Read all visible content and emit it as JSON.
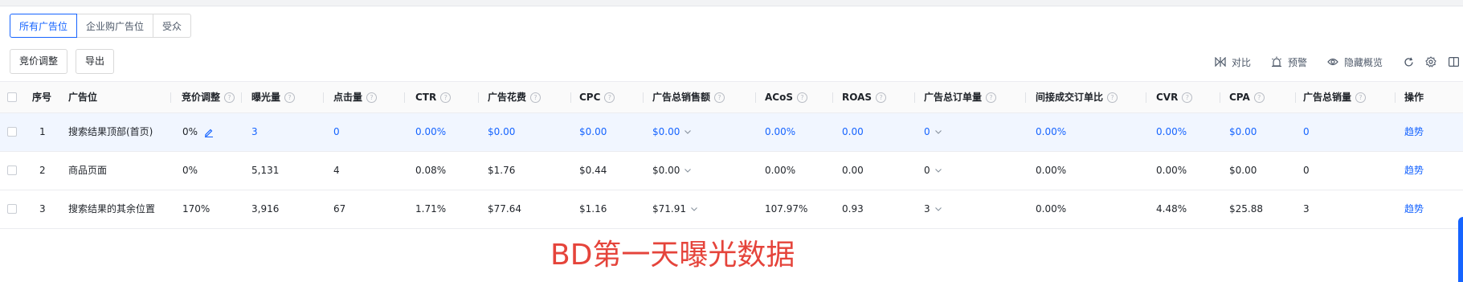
{
  "tabs": [
    "所有广告位",
    "企业购广告位",
    "受众"
  ],
  "actions": {
    "bid_adjust": "竞价调整",
    "export": "导出"
  },
  "toolbar": {
    "compare": "对比",
    "alert": "预警",
    "hide_overview": "隐藏概览"
  },
  "columns": [
    "序号",
    "广告位",
    "竞价调整",
    "曝光量",
    "点击量",
    "CTR",
    "广告花费",
    "CPC",
    "广告总销售额",
    "ACoS",
    "ROAS",
    "广告总订单量",
    "间接成交订单比",
    "CVR",
    "CPA",
    "广告总销量",
    "操作"
  ],
  "rows": [
    {
      "no": "1",
      "placement": "搜索结果顶部(首页)",
      "bid": "0%",
      "impressions": "3",
      "clicks": "0",
      "ctr": "0.00%",
      "spend": "$0.00",
      "cpc": "$0.00",
      "sales": "$0.00",
      "acos": "0.00%",
      "roas": "0.00",
      "orders": "0",
      "indirect": "0.00%",
      "cvr": "0.00%",
      "cpa": "$0.00",
      "units": "0",
      "op": "趋势"
    },
    {
      "no": "2",
      "placement": "商品页面",
      "bid": "0%",
      "impressions": "5,131",
      "clicks": "4",
      "ctr": "0.08%",
      "spend": "$1.76",
      "cpc": "$0.44",
      "sales": "$0.00",
      "acos": "0.00%",
      "roas": "0.00",
      "orders": "0",
      "indirect": "0.00%",
      "cvr": "0.00%",
      "cpa": "$0.00",
      "units": "0",
      "op": "趋势"
    },
    {
      "no": "3",
      "placement": "搜索结果的其余位置",
      "bid": "170%",
      "impressions": "3,916",
      "clicks": "67",
      "ctr": "1.71%",
      "spend": "$77.64",
      "cpc": "$1.16",
      "sales": "$71.91",
      "acos": "107.97%",
      "roas": "0.93",
      "orders": "3",
      "indirect": "0.00%",
      "cvr": "4.48%",
      "cpa": "$25.88",
      "units": "3",
      "op": "趋势"
    }
  ],
  "caption": "BD第一天曝光数据",
  "colors": {
    "accent": "#1664ff",
    "caption": "#e5443b",
    "highlight_row": "#f1f6ff"
  },
  "icons": [
    "compare-icon",
    "alert-icon",
    "eye-icon",
    "refresh-icon",
    "settings-icon",
    "columns-icon",
    "pencil-icon",
    "chevron-down-icon",
    "help-icon"
  ]
}
